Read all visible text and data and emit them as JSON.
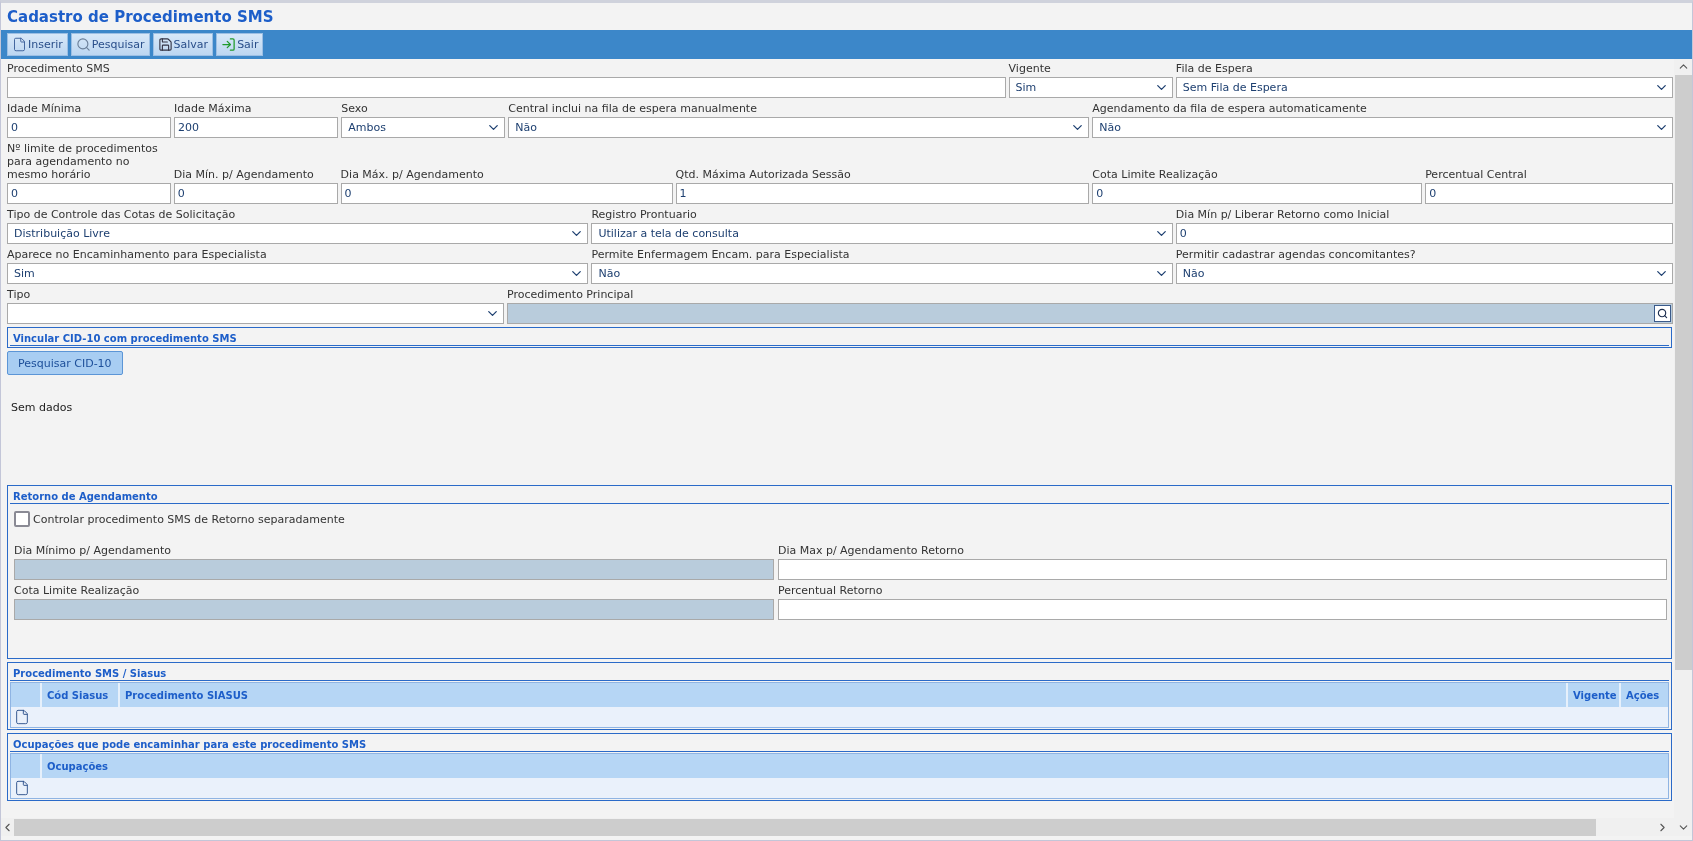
{
  "title": "Cadastro de Procedimento SMS",
  "toolbar": [
    {
      "label": "Inserir",
      "kind": "new"
    },
    {
      "label": "Pesquisar",
      "kind": "search"
    },
    {
      "label": "Salvar",
      "kind": "save"
    },
    {
      "label": "Sair",
      "kind": "exit"
    }
  ],
  "form_rows": [
    {
      "fields": [
        {
          "label": "Procedimento SMS",
          "kind": "input",
          "disabled": false
        },
        {
          "label": "Vigente",
          "kind": "select",
          "value": "Sim",
          "disabled": false
        },
        {
          "label": "Fila de Espera",
          "kind": "select",
          "value": "Sem Fila de Espera",
          "disabled": false
        }
      ]
    },
    {
      "fields": [
        {
          "label": "Idade Mínima",
          "kind": "input",
          "value": "0",
          "disabled": false
        },
        {
          "label": "Idade Máxima",
          "kind": "input",
          "value": "200",
          "disabled": false
        },
        {
          "label": "Sexo",
          "kind": "select",
          "value": "Ambos",
          "disabled": false
        },
        {
          "label": "Central inclui na fila de espera manualmente",
          "kind": "select",
          "value": "Não",
          "disabled": false
        },
        {
          "label": "Agendamento da fila de espera automaticamente",
          "kind": "select",
          "value": "Não",
          "disabled": false
        }
      ]
    },
    {
      "fields": [
        {
          "label": "Nº limite de procedimentos para agendamento no mesmo horário",
          "kind": "input",
          "value": "0",
          "disabled": false
        },
        {
          "label": "Dia Mín. p/ Agendamento",
          "kind": "input",
          "value": "0",
          "disabled": false
        },
        {
          "label": "Dia Máx. p/ Agendamento",
          "kind": "input",
          "value": "0",
          "disabled": false
        },
        {
          "label": "Qtd. Máxima Autorizada Sessão",
          "kind": "input",
          "value": "1",
          "disabled": false
        },
        {
          "label": "Cota Limite Realização",
          "kind": "input",
          "value": "0",
          "disabled": false
        },
        {
          "label": "Percentual Central",
          "kind": "input",
          "value": "0",
          "disabled": false
        }
      ]
    },
    {
      "fields": [
        {
          "label": "Tipo de Controle das Cotas de Solicitação",
          "kind": "select",
          "value": "Distribuição Livre",
          "disabled": false
        },
        {
          "label": "Registro Prontuario",
          "kind": "select",
          "value": "Utilizar a tela de consulta",
          "disabled": false
        },
        {
          "label": "Dia Mín p/ Liberar Retorno como Inicial",
          "kind": "input",
          "value": "0",
          "disabled": false
        }
      ]
    },
    {
      "fields": [
        {
          "label": "Aparece no Encaminhamento para Especialista",
          "kind": "select",
          "value": "Sim",
          "disabled": false
        },
        {
          "label": "Permite Enfermagem Encam. para Especialista",
          "kind": "select",
          "value": "Não",
          "disabled": false
        },
        {
          "label": "Permitir cadastrar agendas concomitantes?",
          "kind": "select",
          "value": "Não",
          "disabled": false
        }
      ]
    },
    {
      "fields": [
        {
          "label": "Tipo",
          "kind": "select",
          "disabled": false
        },
        {
          "label": "Procedimento Principal",
          "kind": "lookup",
          "disabled": true
        }
      ]
    }
  ],
  "cid_section": {
    "title": "Vincular CID-10 com procedimento SMS",
    "button": "Pesquisar CID-10",
    "empty_text": "Sem dados"
  },
  "retorno": {
    "title": "Retorno de Agendamento",
    "checkbox": {
      "label": "Controlar procedimento SMS de Retorno separadamente",
      "checked": false
    },
    "fields": [
      {
        "label": "Dia Mínimo p/ Agendamento",
        "disabled": true
      },
      {
        "label": "Dia Max p/ Agendamento Retorno",
        "disabled": false
      },
      {
        "label": "Cota Limite Realização",
        "disabled": true
      },
      {
        "label": "Percentual Retorno",
        "disabled": false
      }
    ]
  },
  "tables": [
    {
      "title": "Procedimento SMS / Siasus",
      "columns": [
        "Cód Siasus",
        "Procedimento SIASUS",
        "Vigente",
        "Ações"
      ]
    },
    {
      "title": "Ocupações que pode encaminhar para este procedimento SMS",
      "columns": [
        "Ocupações"
      ]
    }
  ]
}
